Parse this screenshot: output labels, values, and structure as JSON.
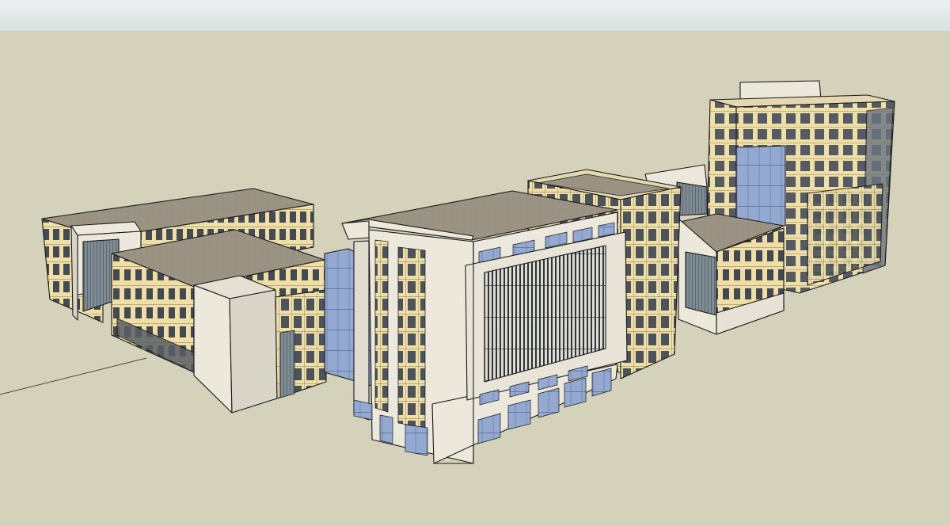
{
  "app": {
    "kind": "3D modeling viewport",
    "tool_cursor": "orbit"
  },
  "scene": {
    "sky_color": "#e6ecec",
    "ground_color": "#d4d2ba",
    "edge_color": "#1a1a1a",
    "facade_light": "#ece8dc",
    "facade_cream": "#efdfa6",
    "roof_color": "#9a9181",
    "glass_color": "#8fa7cf",
    "glass_dark": "#3f4855",
    "buildings": [
      {
        "id": "left-back-block"
      },
      {
        "id": "left-front-block"
      },
      {
        "id": "center-main-tower"
      },
      {
        "id": "mid-right-tower"
      },
      {
        "id": "right-low-block"
      },
      {
        "id": "right-high-tower"
      }
    ]
  }
}
